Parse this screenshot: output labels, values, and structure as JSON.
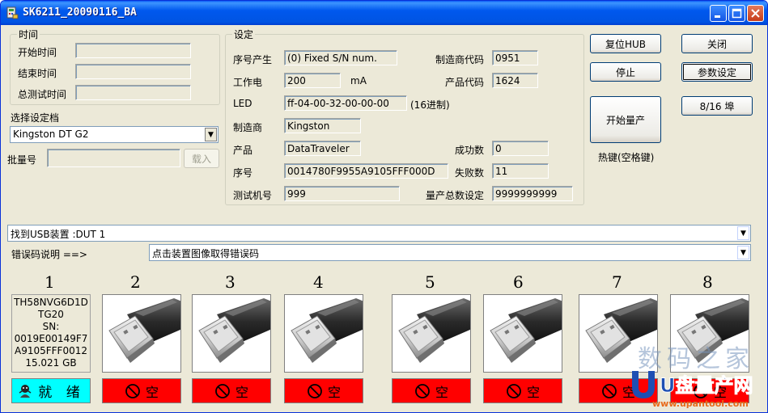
{
  "window": {
    "title": "SK6211_20090116_BA"
  },
  "time_group": {
    "label": "时间",
    "start_label": "开始时间",
    "end_label": "结束时间",
    "total_label": "总测试时间",
    "start_value": "",
    "end_value": "",
    "total_value": ""
  },
  "profile": {
    "label": "选择设定档",
    "selected": "Kingston DT G2"
  },
  "batch": {
    "label": "批量号",
    "value": "",
    "load_button": "载入"
  },
  "settings": {
    "label": "设定",
    "serial_mode_label": "序号产生",
    "serial_mode_value": "(0) Fixed S/N num.",
    "vendor_code_label": "制造商代码",
    "vendor_code_value": "0951",
    "current_label": "工作电",
    "current_value": "200",
    "current_unit": "mA",
    "product_code_label": "产品代码",
    "product_code_value": "1624",
    "led_label": "LED",
    "led_value": "ff-04-00-32-00-00-00",
    "led_note": "(16进制)",
    "manufacturer_label": "制造商",
    "manufacturer_value": "Kingston",
    "product_label": "产品",
    "product_value": "DataTraveler",
    "success_label": "成功数",
    "success_value": "0",
    "serial_label": "序号",
    "serial_value": "0014780F9955A9105FFF000D",
    "fail_label": "失败数",
    "fail_value": "11",
    "tester_label": "测试机号",
    "tester_value": "999",
    "total_set_label": "量产总数设定",
    "total_set_value": "9999999999"
  },
  "buttons": {
    "reset_hub": "复位HUB",
    "close": "关闭",
    "stop": "停止",
    "params": "参数设定",
    "ports": "8/16 埠",
    "start": "开始量产",
    "hotkey": "热键(空格键)"
  },
  "usb_found": {
    "value": "找到USB装置 :DUT 1"
  },
  "error_explain": {
    "label": "错误码说明 ==>",
    "value": "点击装置图像取得错误码"
  },
  "ports": [
    {
      "num": "1",
      "info": [
        "TH58NVG6D1D",
        "TG20",
        "SN:",
        "0019E00149F7",
        "A9105FFF0012",
        "15.021 GB"
      ],
      "status": "就 绪"
    },
    {
      "num": "2",
      "status": "空"
    },
    {
      "num": "3",
      "status": "空"
    },
    {
      "num": "4",
      "status": "空"
    },
    {
      "num": "5",
      "status": "空"
    },
    {
      "num": "6",
      "status": "空"
    },
    {
      "num": "7",
      "status": "空"
    },
    {
      "num": "8",
      "status": "空"
    }
  ],
  "watermark": {
    "cn": "数码之家",
    "brand": "U盘量产网",
    "url": "www.upantool.com"
  },
  "colors": {
    "window_bg": "#ECE9D8",
    "title_blue": "#0054E3",
    "status_red": "#FF0000",
    "status_ready": "#00FFFF"
  }
}
